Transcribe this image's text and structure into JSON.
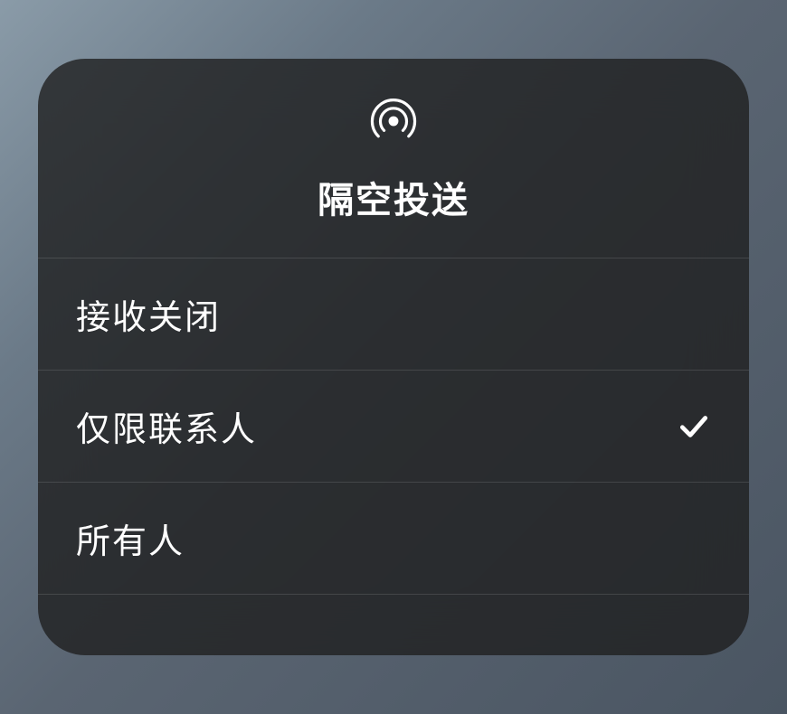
{
  "header": {
    "title": "隔空投送",
    "icon": "airdrop-icon"
  },
  "options": [
    {
      "label": "接收关闭",
      "selected": false
    },
    {
      "label": "仅限联系人",
      "selected": true
    },
    {
      "label": "所有人",
      "selected": false
    }
  ]
}
